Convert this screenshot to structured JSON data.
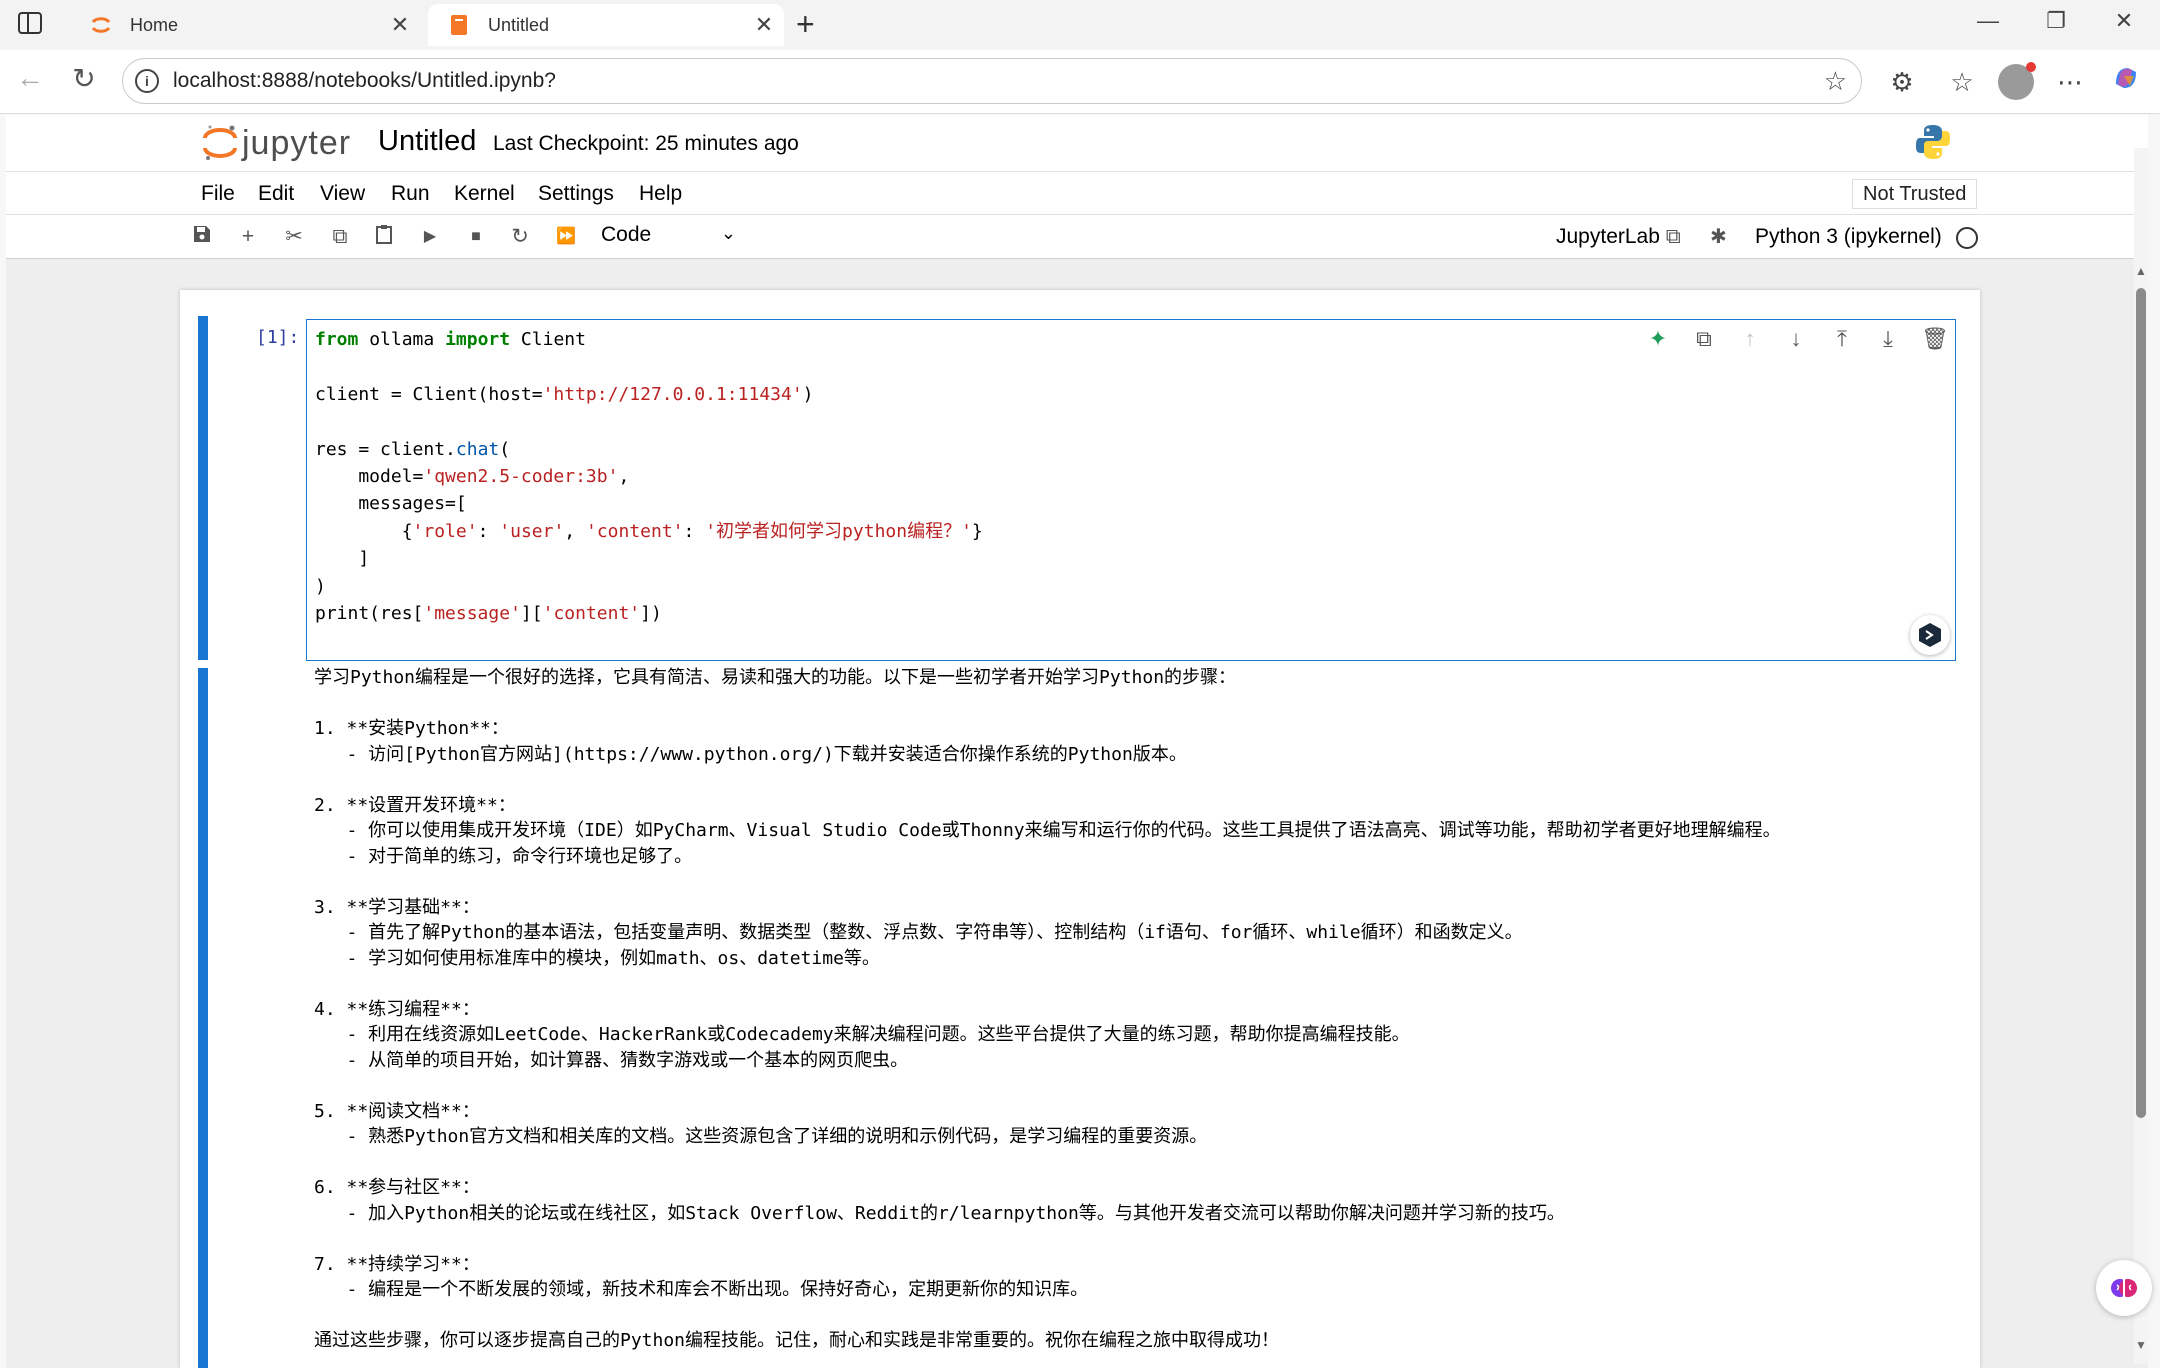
{
  "browser": {
    "tabs": [
      {
        "title": "Home",
        "close": "✕"
      },
      {
        "title": "Untitled",
        "close": "✕"
      }
    ],
    "new_tab": "+",
    "url": "localhost:8888/notebooks/Untitled.ipynb?",
    "window_controls": [
      "—",
      "❐",
      "✕"
    ]
  },
  "jupyter": {
    "wordmark": "jupyter",
    "notebook_name": "Untitled",
    "checkpoint": "Last Checkpoint: 25 minutes ago",
    "menu": [
      "File",
      "Edit",
      "View",
      "Run",
      "Kernel",
      "Settings",
      "Help"
    ],
    "trust_status": "Not Trusted",
    "cell_type": "Code",
    "jupyterlab_link": "JupyterLab",
    "kernel": "Python 3 (ipykernel)"
  },
  "cell": {
    "prompt": "[1]:",
    "code_lines": [
      "from ollama import Client",
      "",
      "client = Client(host='http://127.0.0.1:11434')",
      "",
      "res = client.chat(",
      "    model='qwen2.5-coder:3b',",
      "    messages=[",
      "        {'role': 'user', 'content': '初学者如何学习python编程？'}",
      "    ]",
      ")",
      "print(res['message']['content'])"
    ],
    "output": "学习Python编程是一个很好的选择，它具有简洁、易读和强大的功能。以下是一些初学者开始学习Python的步骤：\n\n1. **安装Python**：\n   - 访问[Python官方网站](https://www.python.org/)下载并安装适合你操作系统的Python版本。\n\n2. **设置开发环境**：\n   - 你可以使用集成开发环境（IDE）如PyCharm、Visual Studio Code或Thonny来编写和运行你的代码。这些工具提供了语法高亮、调试等功能，帮助初学者更好地理解编程。\n   - 对于简单的练习，命令行环境也足够了。\n\n3. **学习基础**：\n   - 首先了解Python的基本语法，包括变量声明、数据类型（整数、浮点数、字符串等）、控制结构（if语句、for循环、while循环）和函数定义。\n   - 学习如何使用标准库中的模块，例如math、os、datetime等。\n\n4. **练习编程**：\n   - 利用在线资源如LeetCode、HackerRank或Codecademy来解决编程问题。这些平台提供了大量的练习题，帮助你提高编程技能。\n   - 从简单的项目开始，如计算器、猜数字游戏或一个基本的网页爬虫。\n\n5. **阅读文档**：\n   - 熟悉Python官方文档和相关库的文档。这些资源包含了详细的说明和示例代码，是学习编程的重要资源。\n\n6. **参与社区**：\n   - 加入Python相关的论坛或在线社区，如Stack Overflow、Reddit的r/learnpython等。与其他开发者交流可以帮助你解决问题并学习新的技巧。\n\n7. **持续学习**：\n   - 编程是一个不断发展的领域，新技术和库会不断出现。保持好奇心，定期更新你的知识库。\n\n通过这些步骤，你可以逐步提高自己的Python编程技能。记住，耐心和实践是非常重要的。祝你在编程之旅中取得成功！"
  },
  "colors": {
    "accent": "#1976d2",
    "keyword": "#008000",
    "string": "#ba2121",
    "jupyter_orange": "#f37726"
  }
}
